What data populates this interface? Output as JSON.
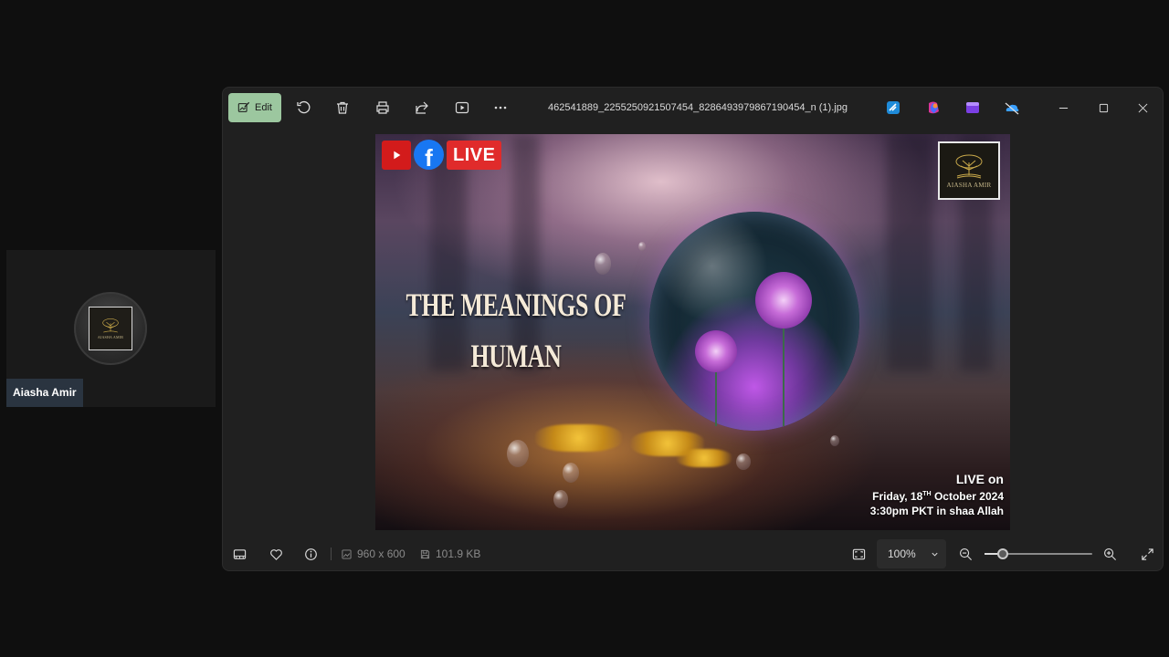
{
  "participant": {
    "name": "Aiasha Amir",
    "logo_text": "AIASHA AMIR"
  },
  "viewer": {
    "edit_label": "Edit",
    "filename": "462541889_2255250921507454_8286493979867190454_n (1).jpg",
    "toolbar_icons": [
      "rotate-icon",
      "delete-icon",
      "print-icon",
      "share-icon",
      "slideshow-icon",
      "more-icon"
    ],
    "app_icons": [
      "clipchamp-icon",
      "copilot-icon",
      "designer-icon",
      "onedrive-icon"
    ],
    "window_controls": [
      "minimize-icon",
      "maximize-icon",
      "close-icon"
    ],
    "dimensions": "960 x 600",
    "file_size": "101.9 KB",
    "zoom": "100%",
    "zoom_slider_fraction": 0.17
  },
  "poster": {
    "live_badge": "LIVE",
    "title_line1": "THE MEANINGS OF",
    "title_line2": "HUMAN",
    "brand_text": "AIASHA AMIR",
    "live_on": "LIVE on",
    "date_prefix": "Friday, 18",
    "date_sup": "TH",
    "date_suffix": " October 2024",
    "time": "3:30pm PKT in shaa Allah"
  }
}
